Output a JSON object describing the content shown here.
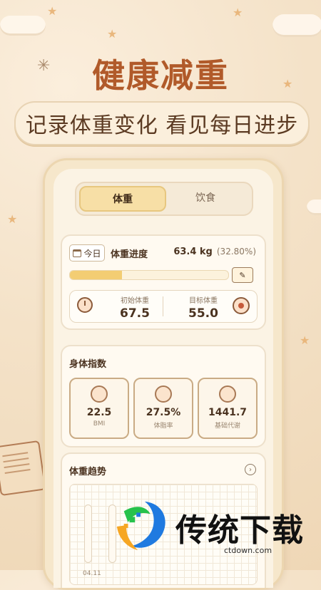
{
  "promo": {
    "headline": "健康减重",
    "subtitle": "记录体重变化 看见每日进步"
  },
  "tabs": [
    {
      "label": "体重",
      "active": true
    },
    {
      "label": "饮食",
      "active": false
    }
  ],
  "weight_progress": {
    "today_label": "今日",
    "title": "体重进度",
    "current_value": "63.4 kg",
    "percent_text": "(32.80%)",
    "progress_fraction": 0.328,
    "start": {
      "label": "初始体重",
      "value": "67.5"
    },
    "target": {
      "label": "目标体重",
      "value": "55.0"
    }
  },
  "body_metrics": {
    "title": "身体指数",
    "items": [
      {
        "value": "22.5",
        "label": "BMI",
        "icon": "bmi-icon"
      },
      {
        "value": "27.5%",
        "label": "体脂率",
        "icon": "body-fat-icon"
      },
      {
        "value": "1441.7",
        "label": "基础代谢",
        "icon": "metabolism-icon"
      }
    ]
  },
  "trend": {
    "title": "体重趋势",
    "x_label": "04.11"
  },
  "watermark": {
    "name": "传统下载",
    "url": "ctdown.com"
  },
  "colors": {
    "accent": "#b15a2a",
    "progress": "#f3cd73",
    "tab_active": "#f7dfa6",
    "background": "#f4e2c8"
  }
}
